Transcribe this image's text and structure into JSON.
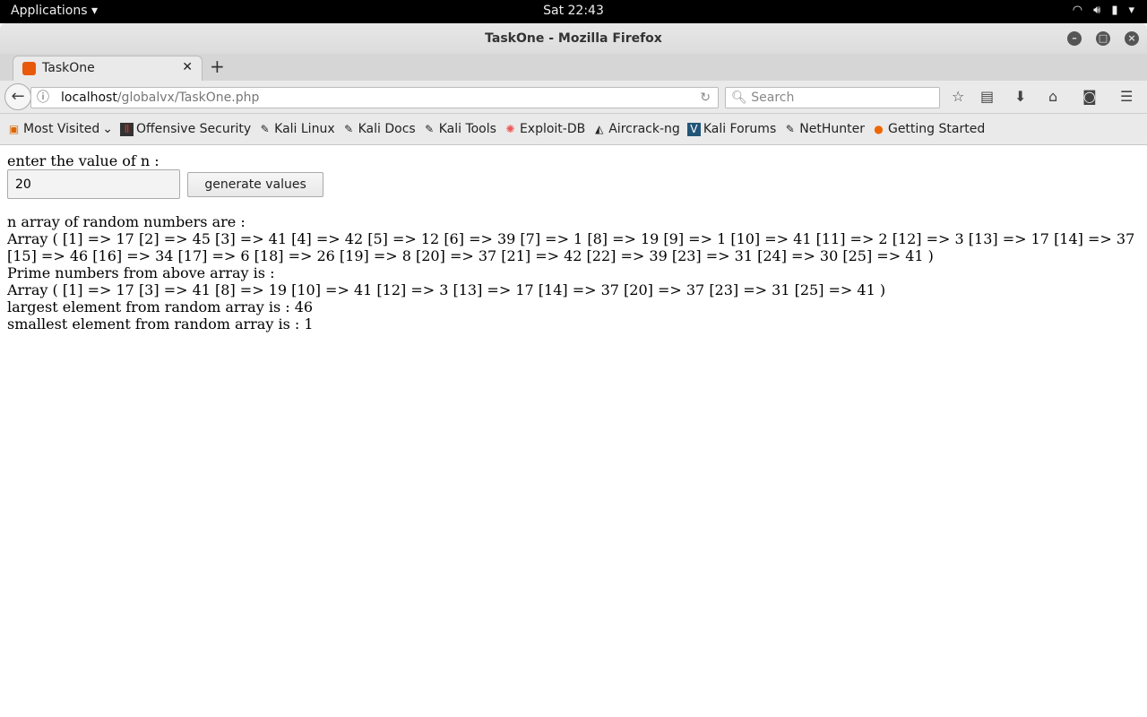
{
  "system": {
    "applications": "Applications",
    "clock": "Sat 22:43"
  },
  "window": {
    "title": "TaskOne - Mozilla Firefox"
  },
  "tabs": [
    {
      "label": "TaskOne"
    }
  ],
  "navbar": {
    "url_host": "localhost",
    "url_path": "/globalvx/TaskOne.php",
    "search_placeholder": "Search"
  },
  "bookmarks": [
    {
      "label": "Most Visited",
      "icon": "folder-icon"
    },
    {
      "label": "Offensive Security",
      "icon": "offsec-icon"
    },
    {
      "label": "Kali Linux",
      "icon": "kali-icon"
    },
    {
      "label": "Kali Docs",
      "icon": "kali-icon"
    },
    {
      "label": "Kali Tools",
      "icon": "kali-icon"
    },
    {
      "label": "Exploit-DB",
      "icon": "exploitdb-icon"
    },
    {
      "label": "Aircrack-ng",
      "icon": "aircrack-icon"
    },
    {
      "label": "Kali Forums",
      "icon": "forums-icon"
    },
    {
      "label": "NetHunter",
      "icon": "kali-icon"
    },
    {
      "label": "Getting Started",
      "icon": "firefox-icon"
    }
  ],
  "page": {
    "prompt": "enter the value of n :",
    "n_value": "20",
    "generate_label": "generate values",
    "random_heading": "n array of random numbers are :",
    "random_array": "Array ( [1] => 17 [2] => 45 [3] => 41 [4] => 42 [5] => 12 [6] => 39 [7] => 1 [8] => 19 [9] => 1 [10] => 41 [11] => 2 [12] => 3 [13] => 17 [14] => 37 [15] => 46 [16] => 34 [17] => 6 [18] => 26 [19] => 8 [20] => 37 [21] => 42 [22] => 39 [23] => 31 [24] => 30 [25] => 41 )",
    "prime_heading": "Prime numbers from above array is :",
    "prime_array": "Array ( [1] => 17 [3] => 41 [8] => 19 [10] => 41 [12] => 3 [13] => 17 [14] => 37 [20] => 37 [23] => 31 [25] => 41 )",
    "largest": "largest element from random array is : 46",
    "smallest": "smallest element from random array is : 1"
  }
}
